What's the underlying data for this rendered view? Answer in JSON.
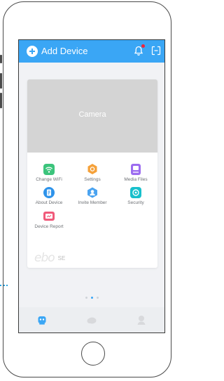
{
  "header": {
    "title": "Add Device",
    "add_icon": "plus-circle-icon",
    "bell_icon": "bell-icon",
    "exit_icon": "exit-icon",
    "background_color": "#3aa6f5",
    "notification_dot_color": "#f0243c"
  },
  "device_card": {
    "preview_label": "Camera",
    "menu": [
      {
        "label": "Change WiFi",
        "icon": "wifi-icon",
        "color": "#3cc47c"
      },
      {
        "label": "Settings",
        "icon": "settings-gear-icon",
        "color": "#f5a13a"
      },
      {
        "label": "Media Files",
        "icon": "media-files-icon",
        "color": "#9c6cf0"
      },
      {
        "label": "About Device",
        "icon": "about-device-icon",
        "color": "#2e93ea"
      },
      {
        "label": "Invite Member",
        "icon": "invite-member-icon",
        "color": "#4aa3f0"
      },
      {
        "label": "Security",
        "icon": "security-icon",
        "color": "#18c0cc"
      },
      {
        "label": "Device Report",
        "icon": "device-report-icon",
        "color": "#f05a7a"
      }
    ],
    "brand_logo": "ebo",
    "brand_model": "SE"
  },
  "pager": {
    "count": 3,
    "active": 1
  },
  "tabbar": {
    "tabs": [
      {
        "icon": "robot-home-icon",
        "active": true
      },
      {
        "icon": "cloud-icon",
        "active": false
      },
      {
        "icon": "profile-icon",
        "active": false
      }
    ],
    "active_color": "#3aa6f5",
    "inactive_color": "#d8d9dc"
  }
}
